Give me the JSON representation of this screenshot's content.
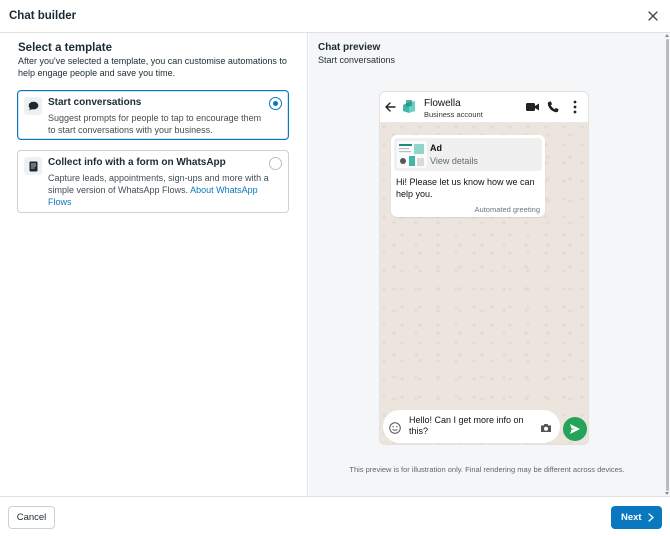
{
  "dialog": {
    "title": "Chat builder"
  },
  "templates": {
    "heading": "Select a template",
    "description": "After you've selected a template, you can customise automations to help engage people and save you time.",
    "options": [
      {
        "title": "Start conversations",
        "description": "Suggest prompts for people to tap to encourage them to start conversations with your business.",
        "selected": true,
        "icon": "chat-bubble-icon"
      },
      {
        "title": "Collect info with a form on WhatsApp",
        "description": "Capture leads, appointments, sign-ups and more with a simple version of WhatsApp Flows.",
        "link": "About WhatsApp Flows",
        "selected": false,
        "icon": "form-icon"
      }
    ]
  },
  "preview": {
    "heading": "Chat preview",
    "subheading": "Start conversations",
    "business_name": "Flowella",
    "business_type": "Business account",
    "ad_label": "Ad",
    "ad_link": "View details",
    "greeting": "Hi! Please let us know how we can help you.",
    "greeting_tag": "Automated greeting",
    "composer_text": "Hello! Can I get more info on this?",
    "disclaimer": "This preview is for illustration only. Final rendering may be different across devices."
  },
  "footer": {
    "cancel_label": "Cancel",
    "next_label": "Next"
  },
  "colors": {
    "accent": "#0a78be",
    "whatsapp_green": "#25a35a",
    "chat_bg": "#ece5dd"
  }
}
